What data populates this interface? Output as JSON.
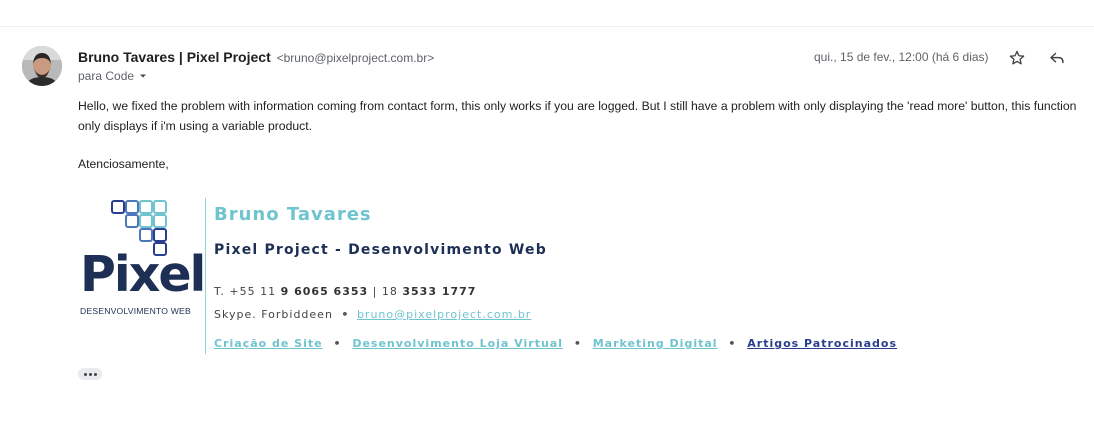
{
  "message": {
    "sender_name": "Bruno Tavares | Pixel Project",
    "sender_email": "<bruno@pixelproject.com.br>",
    "recipient_label": "para Code",
    "date": "qui., 15 de fev., 12:00 (há 6 dias)",
    "body": "Hello, we fixed the problem with information coming from contact form, this only works if you are logged. But I still have a problem with only displaying the 'read more' button, this function only displays if i'm using a variable product.",
    "closing": "Atenciosamente,"
  },
  "icons": {
    "avatar": "avatar-photo",
    "star": "star-icon",
    "reply": "reply-icon",
    "dropdown": "chevron-down-icon",
    "more": "more-horizontal-icon"
  },
  "signature": {
    "logo_word": "Pixel",
    "logo_sub": "DESENVOLVIMENTO WEB",
    "name": "Bruno Tavares",
    "company": "Pixel Project - Desenvolvimento Web",
    "phone_prefix": "T. +55 11",
    "phone_main": "9 6065 6353",
    "phone_sep": "| 18",
    "phone_second": "3533 1777",
    "skype": "Skype. Forbiddeen",
    "email": "bruno@pixelproject.com.br",
    "links": [
      "Criação de Site",
      "Desenvolvimento Loja Virtual",
      "Marketing Digital",
      "Artigos Patrocinados"
    ]
  },
  "colors": {
    "teal": "#6fc4cf",
    "navy": "#1e2f55",
    "link_blue": "#2a3e8f"
  }
}
